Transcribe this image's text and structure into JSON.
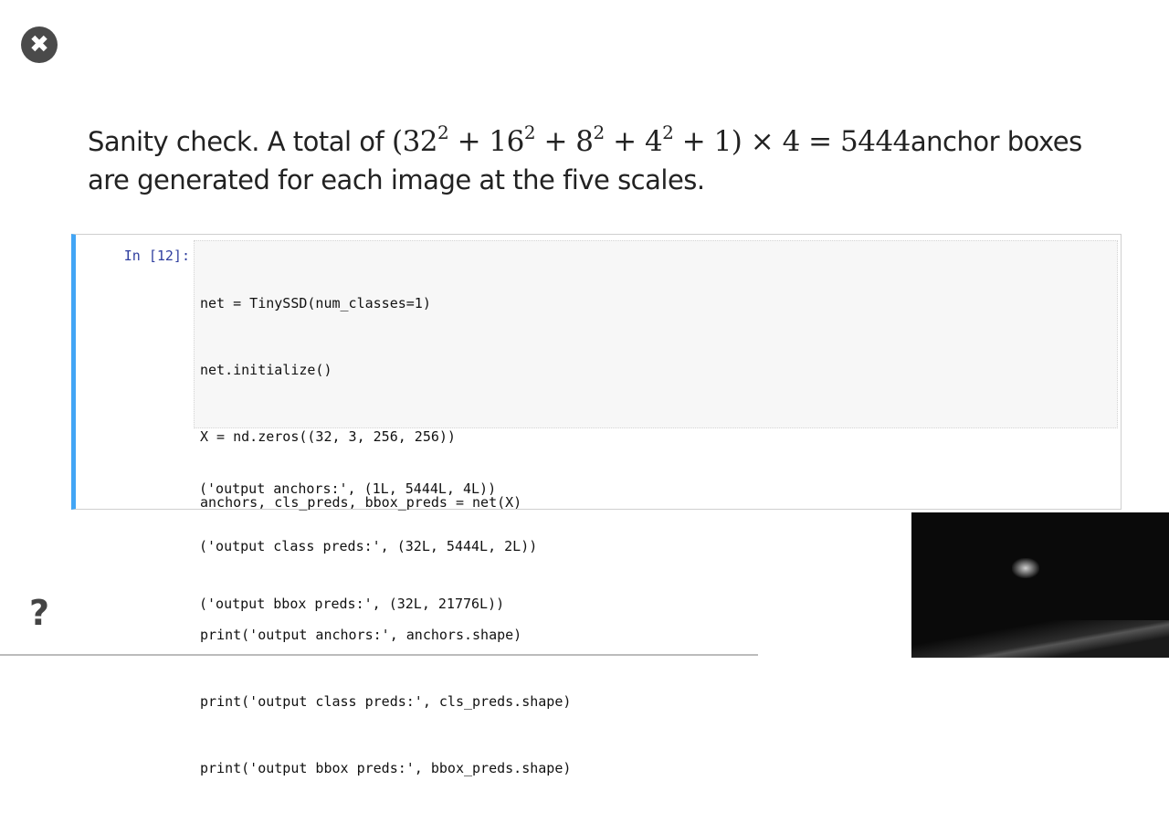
{
  "window": {
    "close_icon_glyph": "✖",
    "help_icon_glyph": "?"
  },
  "slide": {
    "line1_prefix": "Sanity check. A total of ",
    "math": {
      "open": "(32",
      "exp1": "2",
      "t2": " + 16",
      "exp2": "2",
      "t3": " + 8",
      "exp3": "2",
      "t4": " + 4",
      "exp4": "2",
      "t5": " + 1) × 4 = 5444"
    },
    "line1_suffix": "anchor boxes",
    "line2": "are generated for each image at the five scales."
  },
  "cell": {
    "prompt": "In [12]:",
    "code_lines": [
      "net = TinySSD(num_classes=1)",
      "net.initialize()",
      "X = nd.zeros((32, 3, 256, 256))",
      "anchors, cls_preds, bbox_preds = net(X)",
      "",
      "print('output anchors:', anchors.shape)",
      "print('output class preds:', cls_preds.shape)",
      "print('output bbox preds:', bbox_preds.shape)"
    ],
    "output_lines": [
      "('output anchors:', (1L, 5444L, 4L))",
      "('output class preds:', (32L, 5444L, 2L))",
      "('output bbox preds:', (32L, 21776L))"
    ]
  },
  "colors": {
    "cell_border_active": "#42a5f5",
    "prompt": "#303f9f",
    "input_bg": "#f7f7f7"
  }
}
